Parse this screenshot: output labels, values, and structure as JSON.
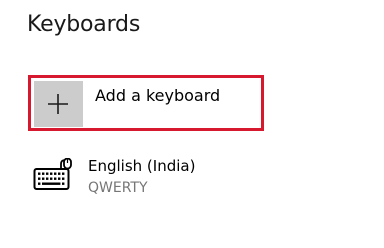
{
  "page": {
    "title": "Keyboards"
  },
  "add_keyboard": {
    "label": "Add a keyboard",
    "icon": "plus-icon",
    "highlight_color": "#d7192f",
    "tile_color": "#cccccc"
  },
  "keyboards": [
    {
      "name": "English (India)",
      "layout": "QWERTY",
      "icon": "keyboard-icon"
    }
  ]
}
